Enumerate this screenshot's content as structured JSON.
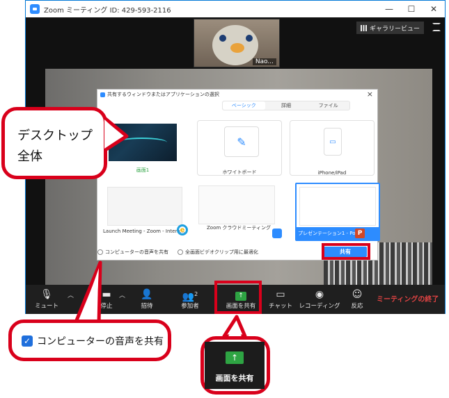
{
  "window": {
    "title": "Zoom ミーティング ID: 429-593-2116",
    "minimize": "—",
    "maximize": "☐",
    "close": "✕"
  },
  "video": {
    "participant_name": "Nao...",
    "gallery_view": "ギャラリービュー"
  },
  "dialog": {
    "title": "共有するウィンドウまたはアプリケーションの選択",
    "close": "×",
    "tabs": [
      "ベーシック",
      "詳細",
      "ファイル"
    ],
    "tiles": {
      "desktop": "画面1",
      "whiteboard": "ホワイトボード",
      "iphone": "iPhone/iPad",
      "launch": "Launch Meeting - Zoom - Intern...",
      "zoom_room": "Zoom クラウドミーティング",
      "presentation": "プレゼンテーション1 - Pow..."
    },
    "share_audio": "コンピューターの音声を共有",
    "optimize_video": "全画面ビデオクリップ用に最適化",
    "share_button": "共有"
  },
  "toolbar": {
    "mute": "ミュート",
    "stop_video": "停止",
    "invite": "招待",
    "participants": "参加者",
    "participants_count": "2",
    "share_screen": "画面を共有",
    "chat": "チャット",
    "record": "レコーディング",
    "reactions": "反応",
    "end": "ミーティングの終了"
  },
  "callouts": {
    "desktop_line1": "デスクトップ",
    "desktop_line2": "全体",
    "audio_checkbox": "コンピューターの音声を共有",
    "share_big": "画面を共有"
  },
  "colors": {
    "annotation_red": "#d9001b",
    "zoom_blue": "#2d8cff",
    "share_green": "#2ea443"
  }
}
